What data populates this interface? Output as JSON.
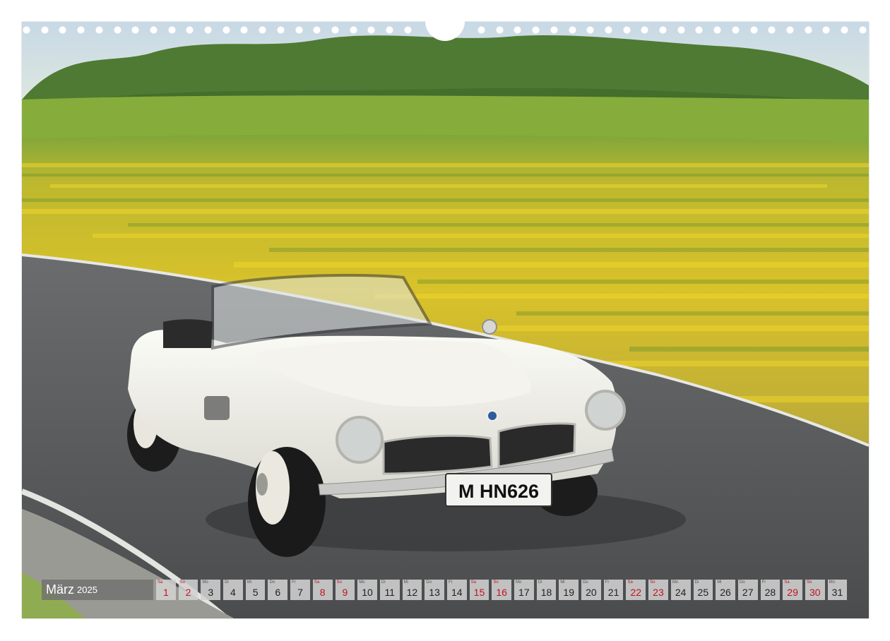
{
  "calendar": {
    "month": "März",
    "year": "2025",
    "days": [
      {
        "wd": "Sa",
        "n": "1",
        "we": true
      },
      {
        "wd": "So",
        "n": "2",
        "we": true
      },
      {
        "wd": "Mo",
        "n": "3",
        "we": false
      },
      {
        "wd": "Di",
        "n": "4",
        "we": false
      },
      {
        "wd": "Mi",
        "n": "5",
        "we": false
      },
      {
        "wd": "Do",
        "n": "6",
        "we": false
      },
      {
        "wd": "Fr",
        "n": "7",
        "we": false
      },
      {
        "wd": "Sa",
        "n": "8",
        "we": true
      },
      {
        "wd": "So",
        "n": "9",
        "we": true
      },
      {
        "wd": "Mo",
        "n": "10",
        "we": false
      },
      {
        "wd": "Di",
        "n": "11",
        "we": false
      },
      {
        "wd": "Mi",
        "n": "12",
        "we": false
      },
      {
        "wd": "Do",
        "n": "13",
        "we": false
      },
      {
        "wd": "Fr",
        "n": "14",
        "we": false
      },
      {
        "wd": "Sa",
        "n": "15",
        "we": true
      },
      {
        "wd": "So",
        "n": "16",
        "we": true
      },
      {
        "wd": "Mo",
        "n": "17",
        "we": false
      },
      {
        "wd": "Di",
        "n": "18",
        "we": false
      },
      {
        "wd": "Mi",
        "n": "19",
        "we": false
      },
      {
        "wd": "Do",
        "n": "20",
        "we": false
      },
      {
        "wd": "Fr",
        "n": "21",
        "we": false
      },
      {
        "wd": "Sa",
        "n": "22",
        "we": true
      },
      {
        "wd": "So",
        "n": "23",
        "we": true
      },
      {
        "wd": "Mo",
        "n": "24",
        "we": false
      },
      {
        "wd": "Di",
        "n": "25",
        "we": false
      },
      {
        "wd": "Mi",
        "n": "26",
        "we": false
      },
      {
        "wd": "Do",
        "n": "27",
        "we": false
      },
      {
        "wd": "Fr",
        "n": "28",
        "we": false
      },
      {
        "wd": "Sa",
        "n": "29",
        "we": true
      },
      {
        "wd": "So",
        "n": "30",
        "we": true
      },
      {
        "wd": "Mo",
        "n": "31",
        "we": false
      }
    ]
  },
  "photo": {
    "license_plate": "M HN626",
    "colors": {
      "sky": "#c9dbe8",
      "trees": "#4d7a32",
      "meadow": "#8fb03c",
      "flowers": "#e3c72a",
      "road": "#555759",
      "car": "#efeee8"
    }
  }
}
